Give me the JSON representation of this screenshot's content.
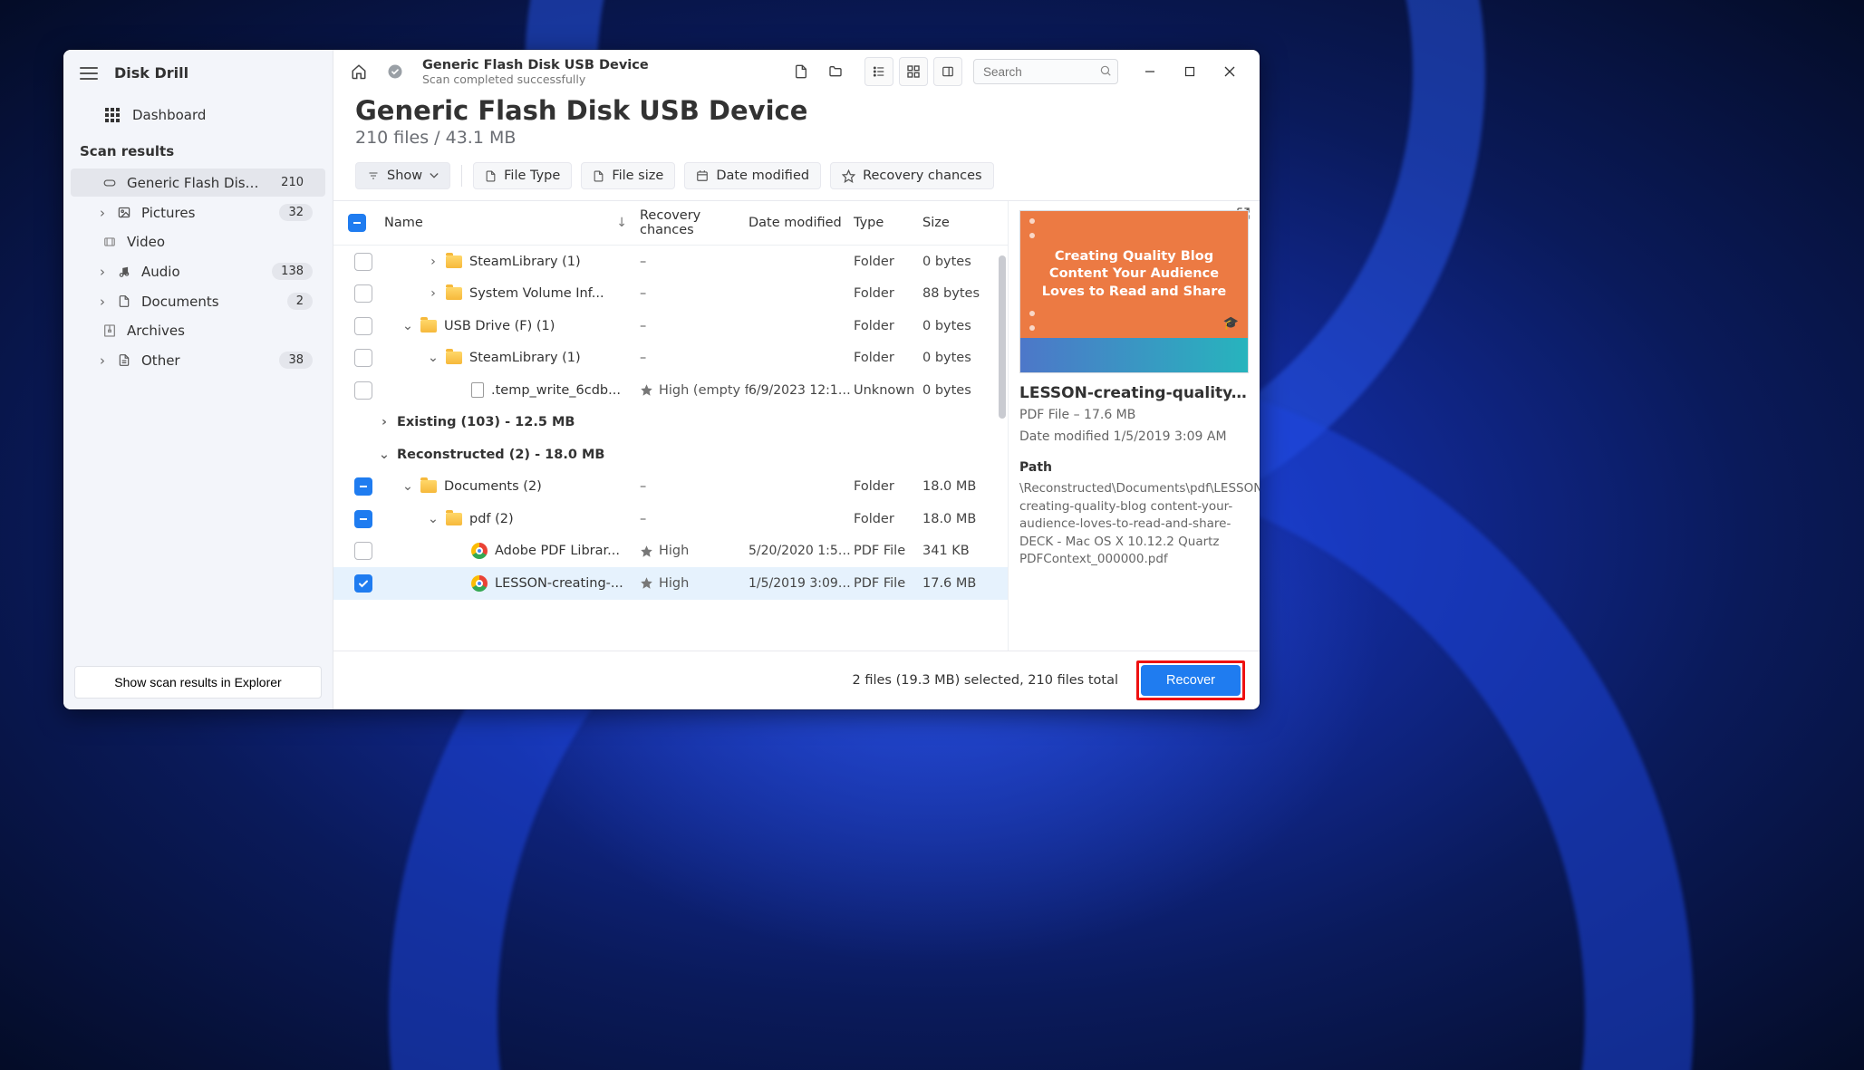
{
  "app": {
    "name": "Disk Drill"
  },
  "sidebar": {
    "dashboard": "Dashboard",
    "scan_results_header": "Scan results",
    "items": [
      {
        "label": "Generic Flash Disk USB...",
        "count": "210",
        "icon": "device",
        "selected": true,
        "indent": 0,
        "caret": ""
      },
      {
        "label": "Pictures",
        "count": "32",
        "icon": "image",
        "indent": 1,
        "caret": ">"
      },
      {
        "label": "Video",
        "count": "",
        "icon": "video",
        "indent": 2,
        "caret": ""
      },
      {
        "label": "Audio",
        "count": "138",
        "icon": "audio",
        "indent": 1,
        "caret": ">"
      },
      {
        "label": "Documents",
        "count": "2",
        "icon": "doc",
        "indent": 1,
        "caret": ">"
      },
      {
        "label": "Archives",
        "count": "",
        "icon": "archive",
        "indent": 2,
        "caret": ""
      },
      {
        "label": "Other",
        "count": "38",
        "icon": "other",
        "indent": 1,
        "caret": ">"
      }
    ],
    "explorer_btn": "Show scan results in Explorer"
  },
  "topbar": {
    "crumb_title": "Generic Flash Disk USB Device",
    "crumb_status": "Scan completed successfully",
    "search_placeholder": "Search"
  },
  "header": {
    "title": "Generic Flash Disk USB Device",
    "subtitle": "210 files / 43.1 MB"
  },
  "filters": {
    "show": "Show",
    "file_type": "File Type",
    "file_size": "File size",
    "date_modified": "Date modified",
    "recovery_chances": "Recovery chances"
  },
  "columns": {
    "name": "Name",
    "recovery": "Recovery chances",
    "date": "Date modified",
    "type": "Type",
    "size": "Size"
  },
  "rows": [
    {
      "kind": "row",
      "check": "empty",
      "depth": 1,
      "exp": ">",
      "icon": "folder",
      "name": "SteamLibrary (1)",
      "rc": "–",
      "dm": "",
      "type": "Folder",
      "size": "0 bytes"
    },
    {
      "kind": "row",
      "check": "empty",
      "depth": 1,
      "exp": ">",
      "icon": "folder",
      "name": "System Volume Inf...",
      "rc": "–",
      "dm": "",
      "type": "Folder",
      "size": "88 bytes"
    },
    {
      "kind": "row",
      "check": "empty",
      "depth": 0,
      "exp": "v",
      "icon": "folder",
      "name": "USB Drive (F) (1)",
      "rc": "–",
      "dm": "",
      "type": "Folder",
      "size": "0 bytes"
    },
    {
      "kind": "row",
      "check": "empty",
      "depth": 1,
      "exp": "v",
      "icon": "folder",
      "name": "SteamLibrary (1)",
      "rc": "–",
      "dm": "",
      "type": "Folder",
      "size": "0 bytes"
    },
    {
      "kind": "row",
      "check": "empty",
      "depth": 2,
      "exp": "",
      "icon": "file",
      "name": ".temp_write_6cdb...",
      "rc": "High (empty fi...",
      "rc_star": true,
      "dm": "6/9/2023 12:14 PM",
      "type": "Unknown",
      "size": "0 bytes"
    },
    {
      "kind": "section",
      "exp": ">",
      "name": "Existing (103) - 12.5 MB"
    },
    {
      "kind": "section",
      "exp": "v",
      "name": "Reconstructed (2) - 18.0 MB"
    },
    {
      "kind": "row",
      "check": "partial",
      "depth": 0,
      "exp": "v",
      "icon": "folder",
      "name": "Documents (2)",
      "rc": "–",
      "dm": "",
      "type": "Folder",
      "size": "18.0 MB"
    },
    {
      "kind": "row",
      "check": "partial",
      "depth": 1,
      "exp": "v",
      "icon": "folder",
      "name": "pdf (2)",
      "rc": "–",
      "dm": "",
      "type": "Folder",
      "size": "18.0 MB"
    },
    {
      "kind": "row",
      "check": "empty",
      "depth": 2,
      "exp": "",
      "icon": "chrome",
      "name": "Adobe PDF Librar...",
      "rc": "High",
      "rc_star": true,
      "dm": "5/20/2020 1:57 A...",
      "type": "PDF File",
      "size": "341 KB"
    },
    {
      "kind": "row",
      "check": "checked",
      "selected": true,
      "depth": 2,
      "exp": "",
      "icon": "chrome",
      "name": "LESSON-creating-...",
      "rc": "High",
      "rc_star": true,
      "dm": "1/5/2019 3:09 AM",
      "type": "PDF File",
      "size": "17.6 MB"
    }
  ],
  "preview": {
    "thumb_text": "Creating Quality Blog Content Your Audience Loves to Read and Share",
    "title": "LESSON-creating-quality...",
    "meta": "PDF File – 17.6 MB",
    "modified": "Date modified 1/5/2019 3:09 AM",
    "path_header": "Path",
    "path": "\\Reconstructed\\Documents\\pdf\\LESSON-creating-quality-blog content-your-audience-loves-to-read-and-share-DECK - Mac OS X 10.12.2 Quartz PDFContext_000000.pdf"
  },
  "footer": {
    "status": "2 files (19.3 MB) selected, 210 files total",
    "recover": "Recover"
  }
}
